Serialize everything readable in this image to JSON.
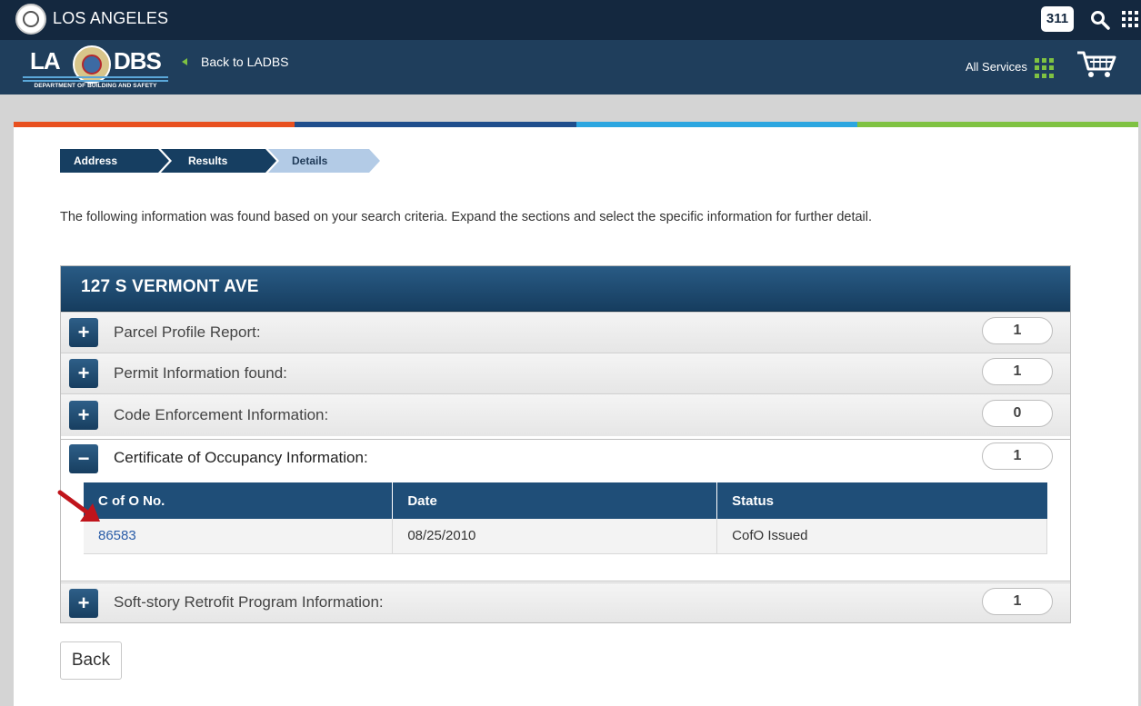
{
  "citybar": {
    "title": "LOS ANGELES",
    "badge": "311",
    "icons": [
      "city-seal-icon",
      "search-icon",
      "apps-grid-icon"
    ]
  },
  "deptbar": {
    "logo_left": "LA",
    "logo_right": "DBS",
    "logo_dept": "DEPARTMENT OF BUILDING AND SAFETY",
    "back_link": "Back to LADBS",
    "all_services": "All Services",
    "icons": [
      "back-arrow-icon",
      "services-grid-icon",
      "cart-icon"
    ]
  },
  "colors": {
    "strip": [
      "#e8501f",
      "#1f4e8c",
      "#2ca6e0",
      "#7fc242"
    ],
    "header": "#14283f",
    "accent": "#1f4e78",
    "link": "#2a5da8"
  },
  "breadcrumb": {
    "steps": [
      "Address",
      "Results",
      "Details"
    ],
    "active": "Details"
  },
  "intro": "The following information was found based on your search criteria. Expand the sections and select the specific information for further detail.",
  "panel": {
    "title": "127 S VERMONT AVE",
    "sections": [
      {
        "label": "Parcel Profile Report:",
        "count": "1",
        "expanded": false
      },
      {
        "label": "Permit Information found:",
        "count": "1",
        "expanded": false
      },
      {
        "label": "Code Enforcement Information:",
        "count": "0",
        "expanded": false
      },
      {
        "label": "Certificate of Occupancy Information:",
        "count": "1",
        "expanded": true
      },
      {
        "label": "Soft-story Retrofit Program Information:",
        "count": "1",
        "expanded": false
      }
    ],
    "cofo_table": {
      "headers": [
        "C of O No.",
        "Date",
        "Status"
      ],
      "rows": [
        {
          "number": "86583",
          "date": "08/25/2010",
          "status": "CofO Issued"
        }
      ]
    }
  },
  "toggles": {
    "expand": "+",
    "collapse": "−"
  },
  "back_button": "Back"
}
